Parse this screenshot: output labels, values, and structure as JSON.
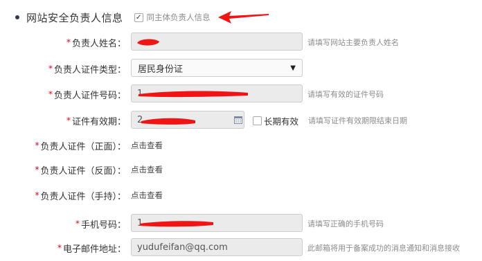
{
  "section": {
    "title": "网站安全负责人信息",
    "same_as_subject_label": "同主体负责人信息",
    "same_as_subject_checked": true
  },
  "fields": {
    "name": {
      "label": "负责人姓名：",
      "value": "",
      "hint": "请填写网站主要负责人姓名"
    },
    "id_type": {
      "label": "负责人证件类型：",
      "selected": "居民身份证"
    },
    "id_number": {
      "label": "负责人证件号码：",
      "value": "1",
      "hint": "请填写有效的证件号码"
    },
    "validity": {
      "label": "证件有效期：",
      "value": "2",
      "long_term_label": "长期有效",
      "long_term_checked": false,
      "hint": "请填写证件有效期限结束日期"
    },
    "id_front": {
      "label": "负责人证件（正面）：",
      "link": "点击查看"
    },
    "id_back": {
      "label": "负责人证件（反面）：",
      "link": "点击查看"
    },
    "id_handheld": {
      "label": "负责人证件（手持）：",
      "link": "点击查看"
    },
    "phone": {
      "label": "手机号码：",
      "value": "1",
      "hint": "请填写正确的手机号码"
    },
    "email": {
      "label": "电子邮件地址：",
      "value": "yudufeifan@qq.com",
      "hint": "此邮箱将用于备案成功的消息通知和消息接收"
    }
  },
  "required_marker": "*",
  "colors": {
    "required": "#e60012",
    "redaction": "#f01414",
    "input_bg": "#ebebeb",
    "hint": "#8c8c8c"
  },
  "icons": {
    "dropdown": "caret-down-icon",
    "calendar": "calendar-icon",
    "annotation": "red-arrow-icon"
  }
}
